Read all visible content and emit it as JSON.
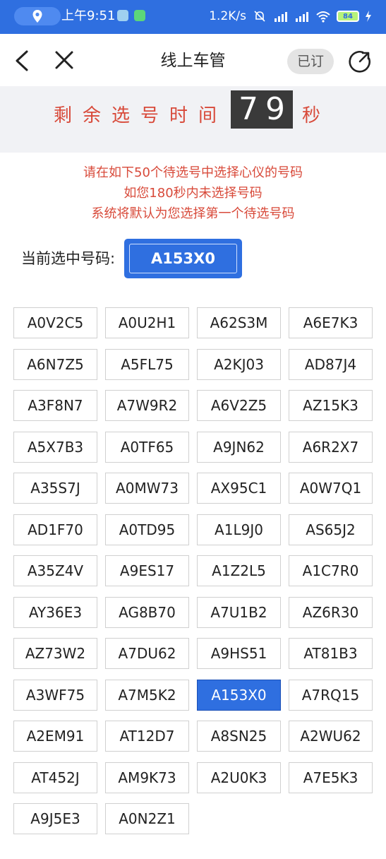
{
  "status_bar": {
    "time": "上午9:51",
    "net_speed": "1.2K/s",
    "battery": "84",
    "colors": {
      "bar": "#2f6fe0",
      "battery_fill": "#b6f27a"
    },
    "icons": [
      "location-icon",
      "telegram-icon",
      "wechat-icon",
      "mute-bell-icon",
      "signal-icon",
      "wifi-icon",
      "battery-icon",
      "charging-icon"
    ]
  },
  "nav": {
    "title": "线上车管",
    "subscribed_badge": "已订",
    "icons": [
      "back-arrow-icon",
      "close-icon",
      "share-icon"
    ]
  },
  "countdown": {
    "label": "剩余选号时间",
    "seconds": "79",
    "unit": "秒",
    "colors": {
      "text": "#d84a3a",
      "box": "#3a3a3a"
    }
  },
  "notice": {
    "line1": "请在如下50个待选号中选择心仪的号码",
    "line2": "如您180秒内未选择号码",
    "line3": "系统将默认为您选择第一个待选号码"
  },
  "current": {
    "label": "当前选中号码:",
    "value": "A153X0"
  },
  "plates": [
    "A0V2C5",
    "A0U2H1",
    "A62S3M",
    "A6E7K3",
    "A6N7Z5",
    "A5FL75",
    "A2KJ03",
    "AD87J4",
    "A3F8N7",
    "A7W9R2",
    "A6V2Z5",
    "AZ15K3",
    "A5X7B3",
    "A0TF65",
    "A9JN62",
    "A6R2X7",
    "A35S7J",
    "A0MW73",
    "AX95C1",
    "A0W7Q1",
    "AD1F70",
    "A0TD95",
    "A1L9J0",
    "AS65J2",
    "A35Z4V",
    "A9ES17",
    "A1Z2L5",
    "A1C7R0",
    "AY36E3",
    "AG8B70",
    "A7U1B2",
    "AZ6R30",
    "AZ73W2",
    "A7DU62",
    "A9HS51",
    "AT81B3",
    "A3WF75",
    "A7M5K2",
    "A153X0",
    "A7RQ15",
    "A2EM91",
    "AT12D7",
    "A8SN25",
    "A2WU62",
    "AT452J",
    "AM9K73",
    "A2U0K3",
    "A7E5K3",
    "A9J5E3",
    "A0N2Z1"
  ],
  "selected_plate": "A153X0",
  "accent_color": "#2f6fe0"
}
